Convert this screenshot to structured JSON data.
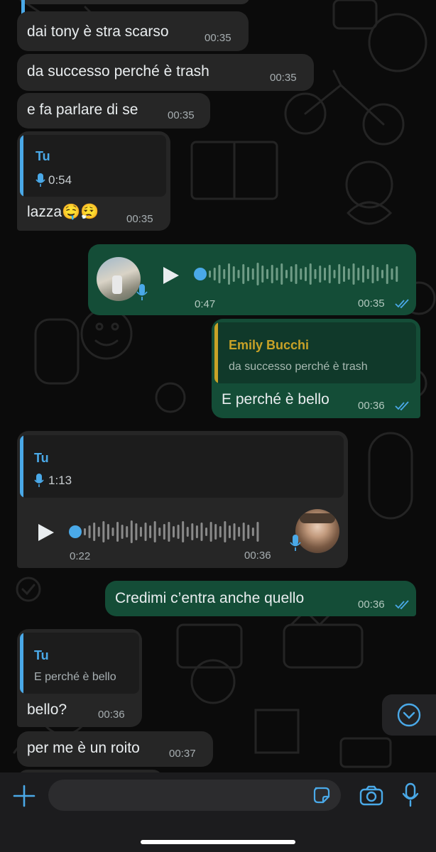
{
  "colors": {
    "incoming": "#262626",
    "outgoing": "#144d37",
    "accent_blue": "#4aa9e8",
    "gold": "#c9a227"
  },
  "messages": [
    {
      "text": "dai tony è stra scarso",
      "time": "00:35"
    },
    {
      "text": "da successo perché è trash",
      "time": "00:35"
    },
    {
      "text": "e fa parlare di se",
      "time": "00:35"
    },
    {
      "quote_name": "Tu",
      "quote_duration": "0:54",
      "text": "lazza🤤😮‍💨",
      "time": "00:35"
    },
    {
      "voice_duration": "0:47",
      "time": "00:35"
    },
    {
      "quote_name": "Emily Bucchi",
      "quote_text": "da successo perché è trash",
      "text": "E perché è bello",
      "time": "00:36"
    },
    {
      "quote_name": "Tu",
      "quote_duration": "1:13",
      "voice_duration": "0:22",
      "time": "00:36"
    },
    {
      "text": "Credimi c’entra anche quello",
      "time": "00:36"
    },
    {
      "quote_name": "Tu",
      "quote_text": "E perché è bello",
      "text": "bello?",
      "time": "00:36"
    },
    {
      "text": "per me è un roito",
      "time": "00:37"
    }
  ],
  "input": {
    "placeholder": ""
  }
}
